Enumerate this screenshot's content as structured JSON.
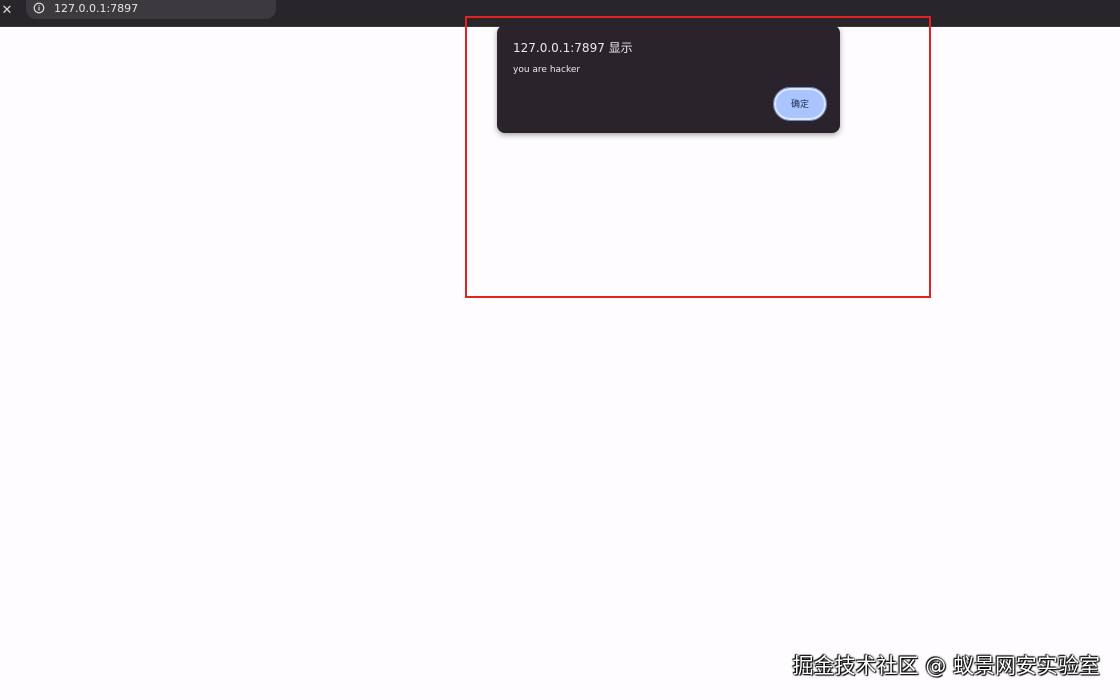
{
  "browser": {
    "url": "127.0.0.1:7897",
    "close_icon": "close-icon",
    "site_info_icon": "info-icon"
  },
  "dialog": {
    "title": "127.0.0.1:7897 显示",
    "message": "you are hacker",
    "ok_label": "确定"
  },
  "annotation": {
    "highlight_color": "#e02424"
  },
  "watermark": {
    "text": "掘金技术社区 @ 蚁景网安实验室"
  },
  "colors": {
    "topbar": "#29262b",
    "dialog_bg": "#2b232b",
    "button_bg": "#a9c4ff",
    "page_bg": "#fefcff"
  }
}
